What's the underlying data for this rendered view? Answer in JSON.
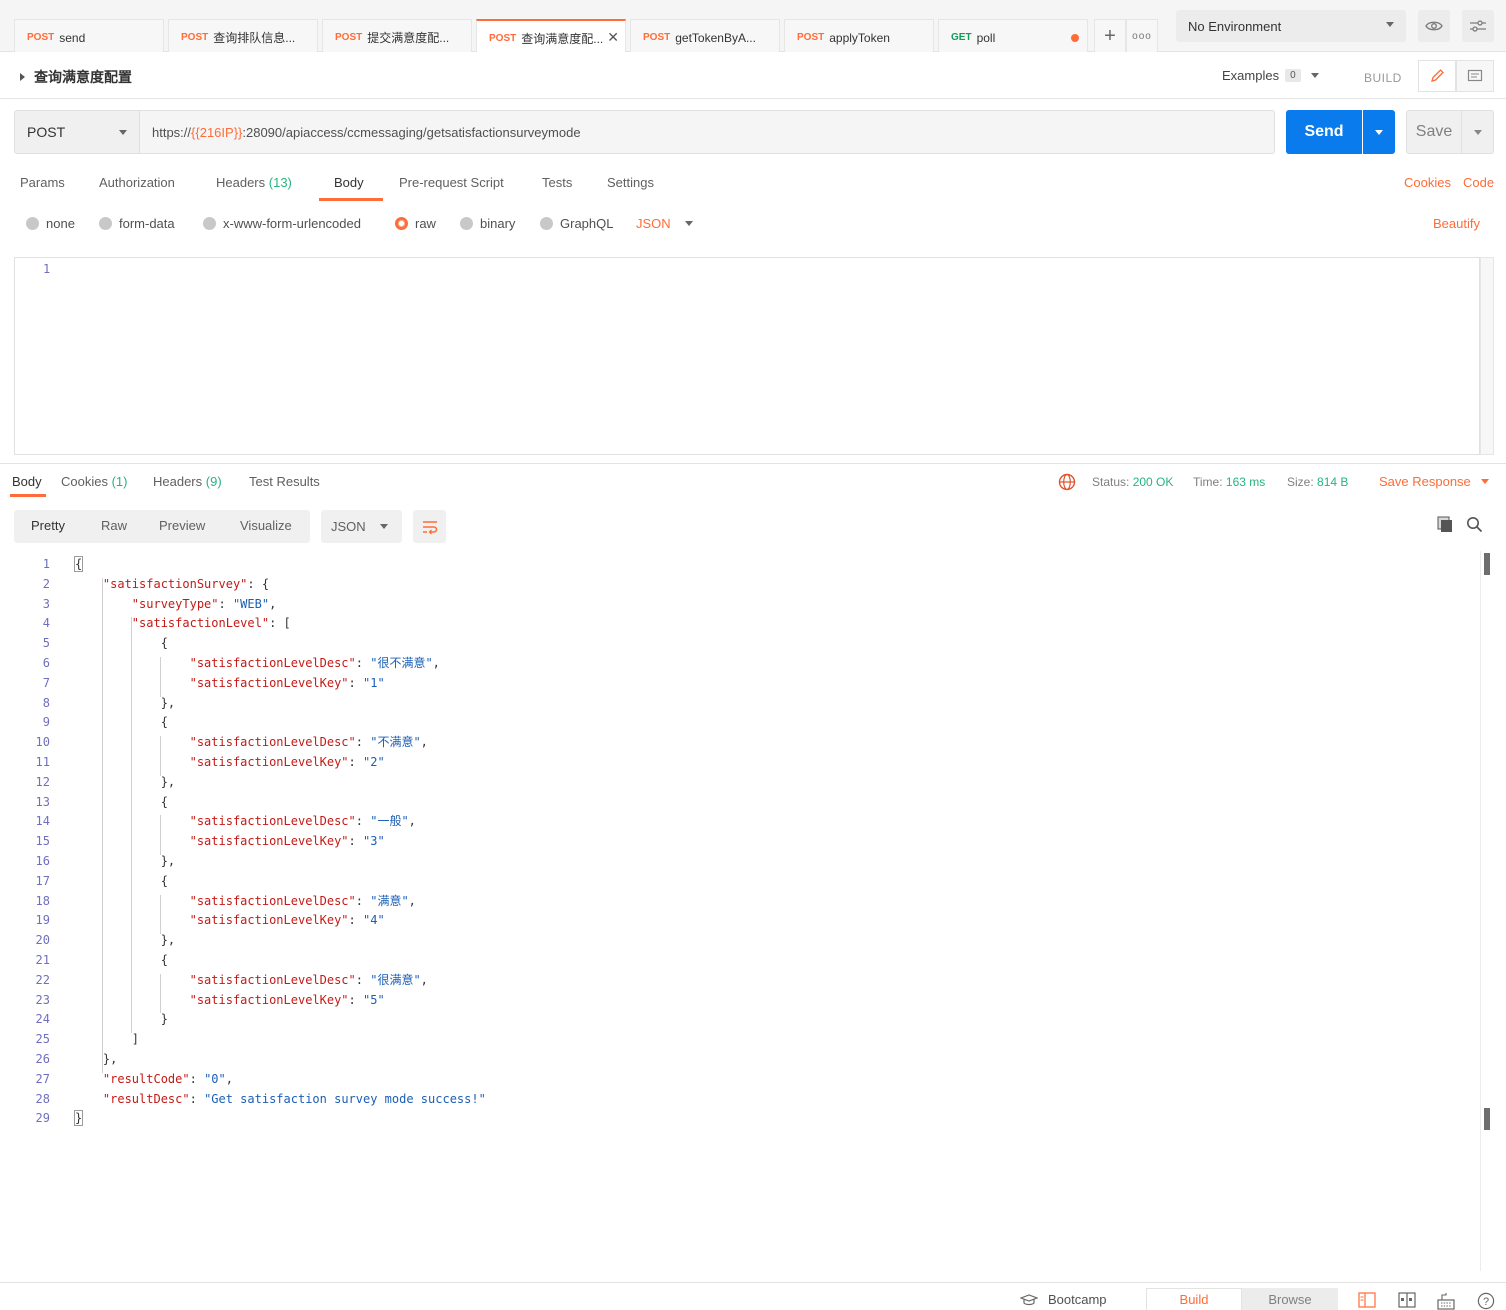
{
  "tabs": [
    {
      "method": "POST",
      "title": "send",
      "active": false
    },
    {
      "method": "POST",
      "title": "查询排队信息...",
      "active": false
    },
    {
      "method": "POST",
      "title": "提交满意度配...",
      "active": false
    },
    {
      "method": "POST",
      "title": "查询满意度配...",
      "active": true
    },
    {
      "method": "POST",
      "title": "getTokenByA...",
      "active": false
    },
    {
      "method": "POST",
      "title": "applyToken",
      "active": false
    },
    {
      "method": "GET",
      "title": "poll",
      "active": false
    }
  ],
  "environment": {
    "selected": "No Environment"
  },
  "request": {
    "name": "查询满意度配置",
    "examples_label": "Examples",
    "examples_count": "0",
    "build_label": "BUILD",
    "method": "POST",
    "url_prefix": "https://",
    "url_var": "{{216IP}}",
    "url_suffix": ":28090/apiaccess/ccmessaging/getsatisfactionsurveymode",
    "send_label": "Send",
    "save_label": "Save"
  },
  "request_tabs": {
    "params": "Params",
    "authorization": "Authorization",
    "headers": "Headers",
    "headers_count": "(13)",
    "body": "Body",
    "prerequest": "Pre-request Script",
    "tests": "Tests",
    "settings": "Settings",
    "cookies": "Cookies",
    "code": "Code"
  },
  "body_options": {
    "none": "none",
    "form_data": "form-data",
    "urlencoded": "x-www-form-urlencoded",
    "raw": "raw",
    "binary": "binary",
    "graphql": "GraphQL",
    "language": "JSON",
    "beautify": "Beautify",
    "selected": "raw"
  },
  "request_body": {
    "line_number": "1"
  },
  "response": {
    "tabs": {
      "body": "Body",
      "cookies": "Cookies",
      "cookies_count": "(1)",
      "headers": "Headers",
      "headers_count": "(9)",
      "test_results": "Test Results"
    },
    "status_label": "Status:",
    "status_value": "200 OK",
    "time_label": "Time:",
    "time_value": "163 ms",
    "size_label": "Size:",
    "size_value": "814 B",
    "save_response": "Save Response",
    "format_buttons": [
      "Pretty",
      "Raw",
      "Preview",
      "Visualize"
    ],
    "language": "JSON",
    "lines": [
      "{",
      "    \"satisfactionSurvey\": {",
      "        \"surveyType\": \"WEB\",",
      "        \"satisfactionLevel\": [",
      "            {",
      "                \"satisfactionLevelDesc\": \"很不满意\",",
      "                \"satisfactionLevelKey\": \"1\"",
      "            },",
      "            {",
      "                \"satisfactionLevelDesc\": \"不满意\",",
      "                \"satisfactionLevelKey\": \"2\"",
      "            },",
      "            {",
      "                \"satisfactionLevelDesc\": \"一般\",",
      "                \"satisfactionLevelKey\": \"3\"",
      "            },",
      "            {",
      "                \"satisfactionLevelDesc\": \"满意\",",
      "                \"satisfactionLevelKey\": \"4\"",
      "            },",
      "            {",
      "                \"satisfactionLevelDesc\": \"很满意\",",
      "                \"satisfactionLevelKey\": \"5\"",
      "            }",
      "        ]",
      "    },",
      "    \"resultCode\": \"0\",",
      "    \"resultDesc\": \"Get satisfaction survey mode success!\"",
      "}"
    ]
  },
  "footer": {
    "bootcamp": "Bootcamp",
    "build": "Build",
    "browse": "Browse"
  },
  "colors": {
    "accent": "#ff6c37",
    "send_blue": "#097bed",
    "success_green": "#26b47f",
    "json_key": "#c41a16",
    "json_string": "#1b5fb5",
    "line_number": "#6f6fc0"
  }
}
